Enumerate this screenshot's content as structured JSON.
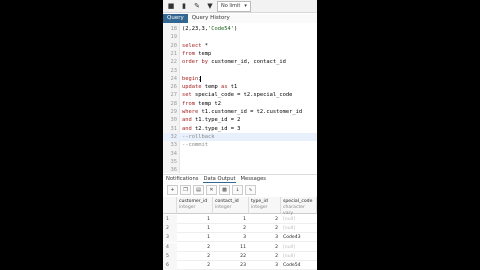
{
  "toolbar": {
    "buttons": [
      "folder-icon",
      "save-icon",
      "pencil-icon",
      "filter-icon",
      "limit-dropdown"
    ],
    "limit_label": "No limit",
    "limit_caret": "▾"
  },
  "tabs": [
    {
      "label": "Query",
      "active": true
    },
    {
      "label": "Query History",
      "active": false
    }
  ],
  "editor": {
    "lines": [
      {
        "n": "",
        "text": "(2,23,3,'Code54')"
      },
      {
        "n": "",
        "text": ""
      },
      {
        "n": "",
        "text": "select *"
      },
      {
        "n": "",
        "text": "from temp"
      },
      {
        "n": "",
        "text": "order by customer_id, contact_id"
      },
      {
        "n": "",
        "text": ""
      },
      {
        "n": "",
        "text": "begin;"
      },
      {
        "n": "26",
        "text": "update temp as t1"
      },
      {
        "n": "27",
        "text": "set special_code = t2.special_code"
      },
      {
        "n": "28",
        "text": "from temp t2"
      },
      {
        "n": "29",
        "text": "where t1.customer_id = t2.customer_id"
      },
      {
        "n": "30",
        "text": "and t1.type_id = 2"
      },
      {
        "n": "31",
        "text": "and t2.type_id = 3"
      },
      {
        "n": "32",
        "text": "--rollback"
      },
      {
        "n": "33",
        "text": "--commit"
      },
      {
        "n": "34",
        "text": ""
      },
      {
        "n": "35",
        "text": ""
      },
      {
        "n": "36",
        "text": ""
      }
    ],
    "line_numbers_upper": [
      "18",
      "19",
      "20",
      "21",
      "22",
      "23",
      "24",
      "25"
    ]
  },
  "panel_tabs": [
    {
      "label": "Notifications",
      "active": false
    },
    {
      "label": "Data Output",
      "active": true
    },
    {
      "label": "Messages",
      "active": false
    }
  ],
  "panel_tools": [
    "add-row-icon",
    "copy-icon",
    "paste-icon",
    "delete-icon",
    "save-data-icon",
    "download-icon",
    "graph-icon"
  ],
  "grid": {
    "columns": [
      {
        "name": "customer_id",
        "type": "integer"
      },
      {
        "name": "contact_id",
        "type": "integer"
      },
      {
        "name": "type_id",
        "type": "integer"
      },
      {
        "name": "special_code",
        "type": "character vary"
      }
    ],
    "rows": [
      {
        "rn": "1",
        "c": [
          "1",
          "1",
          "2",
          "[null]"
        ]
      },
      {
        "rn": "2",
        "c": [
          "1",
          "2",
          "2",
          "[null]"
        ]
      },
      {
        "rn": "3",
        "c": [
          "1",
          "3",
          "3",
          "Code43"
        ]
      },
      {
        "rn": "4",
        "c": [
          "2",
          "11",
          "2",
          "[null]"
        ]
      },
      {
        "rn": "5",
        "c": [
          "2",
          "22",
          "2",
          "[null]"
        ]
      },
      {
        "rn": "6",
        "c": [
          "2",
          "23",
          "3",
          "Code54"
        ]
      }
    ]
  }
}
